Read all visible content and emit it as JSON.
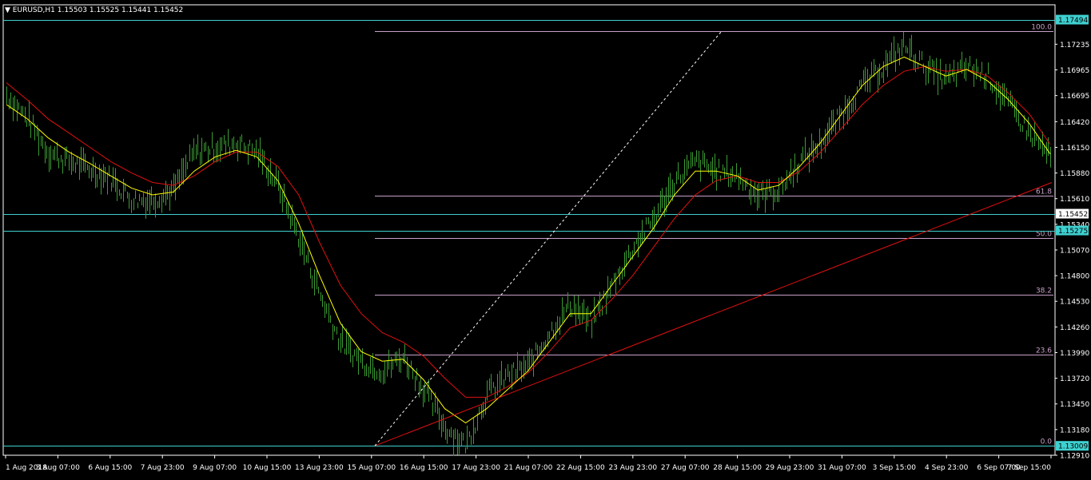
{
  "header": {
    "symbol": "EURUSD,H1",
    "ohlc": "1.15503 1.15525 1.15441 1.15452"
  },
  "colors": {
    "background": "#000000",
    "frame": "#ffffff",
    "bars": "#3c9a34",
    "ma_fast": "#ffff00",
    "ma_slow": "#e01010",
    "horizontal_lines": "#3fd0d0",
    "fibonacci": "#c8a0c8",
    "trendline": "#e01010",
    "fib_trend": "#ffffff",
    "price_label_bg": "#3fd0d0",
    "axis_text": "#ffffff"
  },
  "chart_data": {
    "type": "line",
    "instrument": "EURUSD",
    "timeframe": "H1",
    "y_axis_ticks": [
      "1.17235",
      "1.16965",
      "1.16695",
      "1.16420",
      "1.16150",
      "1.15880",
      "1.15610",
      "1.15340",
      "1.15070",
      "1.14800",
      "1.14530",
      "1.14260",
      "1.13990",
      "1.13720",
      "1.13450",
      "1.13180",
      "1.12910"
    ],
    "ylim": [
      1.1291,
      1.1765
    ],
    "x_axis_ticks": [
      "1 Aug 2018",
      "3 Aug 07:00",
      "6 Aug 15:00",
      "7 Aug 23:00",
      "9 Aug 07:00",
      "10 Aug 15:00",
      "13 Aug 23:00",
      "15 Aug 07:00",
      "16 Aug 15:00",
      "17 Aug 23:00",
      "21 Aug 07:00",
      "22 Aug 15:00",
      "23 Aug 23:00",
      "27 Aug 07:00",
      "28 Aug 15:00",
      "29 Aug 23:00",
      "31 Aug 07:00",
      "3 Sep 15:00",
      "4 Sep 23:00",
      "6 Sep 07:00",
      "7 Sep 15:00"
    ],
    "horizontal_lines": [
      {
        "price": 1.17494,
        "label": "1.17494"
      },
      {
        "price": 1.15452,
        "label": "1.15452"
      },
      {
        "price": 1.15275,
        "label": "1.15275"
      },
      {
        "price": 1.13009,
        "label": "1.13009"
      }
    ],
    "fibonacci_levels": [
      {
        "level": "100.0",
        "price": 1.17374
      },
      {
        "level": "61.8",
        "price": 1.15644
      },
      {
        "level": "50.0",
        "price": 1.15192
      },
      {
        "level": "38.2",
        "price": 1.14602
      },
      {
        "level": "23.6",
        "price": 1.13972
      },
      {
        "level": "0.0",
        "price": 1.13009
      }
    ],
    "price_series": {
      "x": [
        0,
        2,
        4,
        6,
        8,
        10,
        12,
        14,
        16,
        18,
        20,
        22,
        24,
        26,
        28,
        30,
        32,
        34,
        36,
        38,
        40,
        42,
        44,
        46,
        48,
        50,
        52,
        54,
        56,
        58,
        60,
        62,
        64,
        66,
        68,
        70,
        72,
        74,
        76,
        78,
        80,
        82,
        84,
        86,
        88,
        90,
        92,
        94,
        96,
        98,
        100
      ],
      "close": [
        1.167,
        1.1645,
        1.161,
        1.16,
        1.1592,
        1.1582,
        1.156,
        1.156,
        1.157,
        1.161,
        1.1615,
        1.162,
        1.161,
        1.1575,
        1.152,
        1.146,
        1.141,
        1.139,
        1.138,
        1.1395,
        1.136,
        1.132,
        1.1302,
        1.1355,
        1.1375,
        1.1385,
        1.142,
        1.145,
        1.143,
        1.147,
        1.151,
        1.154,
        1.158,
        1.16,
        1.159,
        1.1585,
        1.1565,
        1.157,
        1.16,
        1.162,
        1.165,
        1.168,
        1.17,
        1.1722,
        1.17,
        1.1685,
        1.17,
        1.169,
        1.166,
        1.163,
        1.1605
      ]
    },
    "ma_fast": [
      1.166,
      1.1645,
      1.1625,
      1.161,
      1.1598,
      1.1585,
      1.1572,
      1.1565,
      1.1568,
      1.159,
      1.1605,
      1.1612,
      1.1605,
      1.158,
      1.1535,
      1.148,
      1.143,
      1.14,
      1.139,
      1.1392,
      1.137,
      1.134,
      1.1325,
      1.134,
      1.136,
      1.138,
      1.141,
      1.144,
      1.144,
      1.147,
      1.15,
      1.153,
      1.1565,
      1.159,
      1.159,
      1.1585,
      1.157,
      1.1575,
      1.1595,
      1.162,
      1.165,
      1.168,
      1.17,
      1.171,
      1.17,
      1.169,
      1.1697,
      1.1685,
      1.1665,
      1.164,
      1.1608
    ],
    "ma_slow": [
      1.1683,
      1.1665,
      1.1645,
      1.163,
      1.1615,
      1.16,
      1.1588,
      1.1578,
      1.1575,
      1.1585,
      1.16,
      1.161,
      1.161,
      1.1595,
      1.1565,
      1.1515,
      1.147,
      1.144,
      1.142,
      1.141,
      1.1395,
      1.1372,
      1.1352,
      1.1352,
      1.1363,
      1.1378,
      1.14,
      1.1425,
      1.1433,
      1.1455,
      1.148,
      1.151,
      1.154,
      1.1565,
      1.158,
      1.1585,
      1.1578,
      1.1578,
      1.159,
      1.161,
      1.1635,
      1.166,
      1.168,
      1.1695,
      1.17,
      1.1695,
      1.1697,
      1.169,
      1.1672,
      1.165,
      1.1618
    ]
  }
}
